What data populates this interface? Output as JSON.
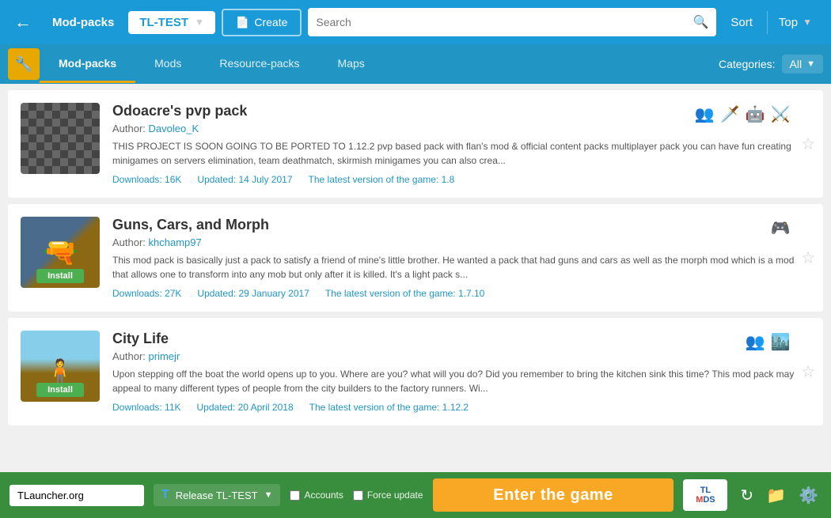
{
  "topBar": {
    "backLabel": "←",
    "appName": "Mod-packs",
    "profileName": "TL-TEST",
    "createLabel": "Create",
    "searchPlaceholder": "Search",
    "sortLabel": "Sort",
    "topLabel": "Top"
  },
  "navTabs": {
    "tabs": [
      {
        "id": "mod-packs",
        "label": "Mod-packs",
        "active": true
      },
      {
        "id": "mods",
        "label": "Mods",
        "active": false
      },
      {
        "id": "resource-packs",
        "label": "Resource-packs",
        "active": false
      },
      {
        "id": "maps",
        "label": "Maps",
        "active": false
      }
    ],
    "categoriesLabel": "Categories:",
    "categoriesValue": "All"
  },
  "mods": [
    {
      "id": "odoacre",
      "title": "Odoacre's pvp pack",
      "author": "Davoleo_K",
      "description": "THIS PROJECT IS SOON GOING TO BE PORTED TO 1.12.2 pvp based pack with flan's mod & official content packs multiplayer pack you can have fun creating minigames on servers elimination, team deathmatch, skirmish minigames you can also crea...",
      "downloads": "16K",
      "updated": "14 July 2017",
      "version": "1.8",
      "tags": [
        "👥",
        "🗡️",
        "🤖",
        "⚔️"
      ],
      "hasInstall": false
    },
    {
      "id": "guns-cars-morph",
      "title": "Guns, Cars, and Morph",
      "author": "khchamp97",
      "description": "This mod pack is basically just a pack to satisfy a friend of mine's little brother. He wanted a pack that had guns and cars as well as the morph mod which is a mod that allows one to transform into any mob but only after it is killed. It's a light pack s...",
      "downloads": "27K",
      "updated": "29 January 2017",
      "version": "1.7.10",
      "tags": [
        "🎮"
      ],
      "hasInstall": true,
      "installLabel": "Install"
    },
    {
      "id": "city-life",
      "title": "City Life",
      "author": "primejr",
      "description": "Upon stepping off the boat the world opens up to you. Where are you? what will you do? Did you remember to bring the kitchen sink this time? This mod pack may appeal to many different types of people from the city builders to the factory runners. Wi...",
      "downloads": "11K",
      "updated": "20 April 2018",
      "version": "1.12.2",
      "tags": [
        "👥",
        "🏙️"
      ],
      "hasInstall": true,
      "installLabel": "Install"
    }
  ],
  "bottomBar": {
    "url": "TLauncher.org",
    "accountsLabel": "Accounts",
    "forceUpdateLabel": "Force update",
    "enterGameLabel": "Enter the game",
    "tlLogo": "TL\nMDS",
    "releaseText": "Release TL-TEST"
  }
}
